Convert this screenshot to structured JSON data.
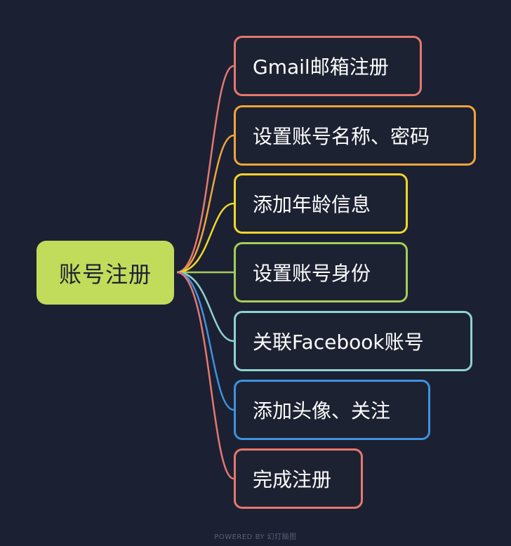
{
  "root": {
    "label": "账号注册",
    "color": "#c1db5b"
  },
  "children": [
    {
      "label": "Gmail邮箱注册",
      "color": "#e6786e"
    },
    {
      "label": "设置账号名称、密码",
      "color": "#f1a43a"
    },
    {
      "label": "添加年龄信息",
      "color": "#f3d52c"
    },
    {
      "label": "设置账号身份",
      "color": "#a6cd56"
    },
    {
      "label": "关联Facebook账号",
      "color": "#8fd2d0"
    },
    {
      "label": "添加头像、关注",
      "color": "#3f92e0"
    },
    {
      "label": "完成注册",
      "color": "#e6786e"
    }
  ],
  "footer": {
    "text": "POWERED BY 幻灯脑图"
  }
}
